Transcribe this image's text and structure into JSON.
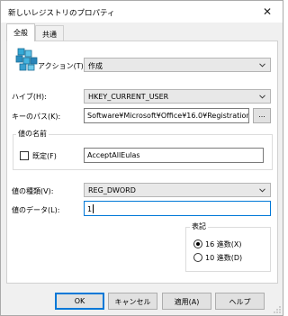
{
  "window": {
    "title": "新しいレジストリのプロパティ",
    "close_glyph": "✕"
  },
  "tabs": [
    {
      "label": "全般",
      "active": true
    },
    {
      "label": "共通",
      "active": false
    }
  ],
  "action": {
    "label": "アクション(T):",
    "value": "作成"
  },
  "hive": {
    "label": "ハイブ(H):",
    "value": "HKEY_CURRENT_USER"
  },
  "key_path": {
    "label": "キーのパス(K):",
    "value": "Software¥Microsoft¥Office¥16.0¥Registration",
    "browse_label": "..."
  },
  "value_name": {
    "group_title": "値の名前",
    "default_label": "既定(F)",
    "default_checked": false,
    "value": "AcceptAllEulas"
  },
  "value_type": {
    "label": "値の種類(V):",
    "value": "REG_DWORD"
  },
  "value_data": {
    "label": "値のデータ(L):",
    "value": "1"
  },
  "base": {
    "title": "表記",
    "options": [
      {
        "label": "16 進数(X)",
        "checked": true
      },
      {
        "label": "10 進数(D)",
        "checked": false
      }
    ]
  },
  "buttons": {
    "ok": "OK",
    "cancel": "キャンセル",
    "apply": "適用(A)",
    "help": "ヘルプ"
  },
  "colors": {
    "focus": "#0078d7",
    "dialog_bg": "#f0f0f0",
    "panel_bg": "#ffffff"
  }
}
